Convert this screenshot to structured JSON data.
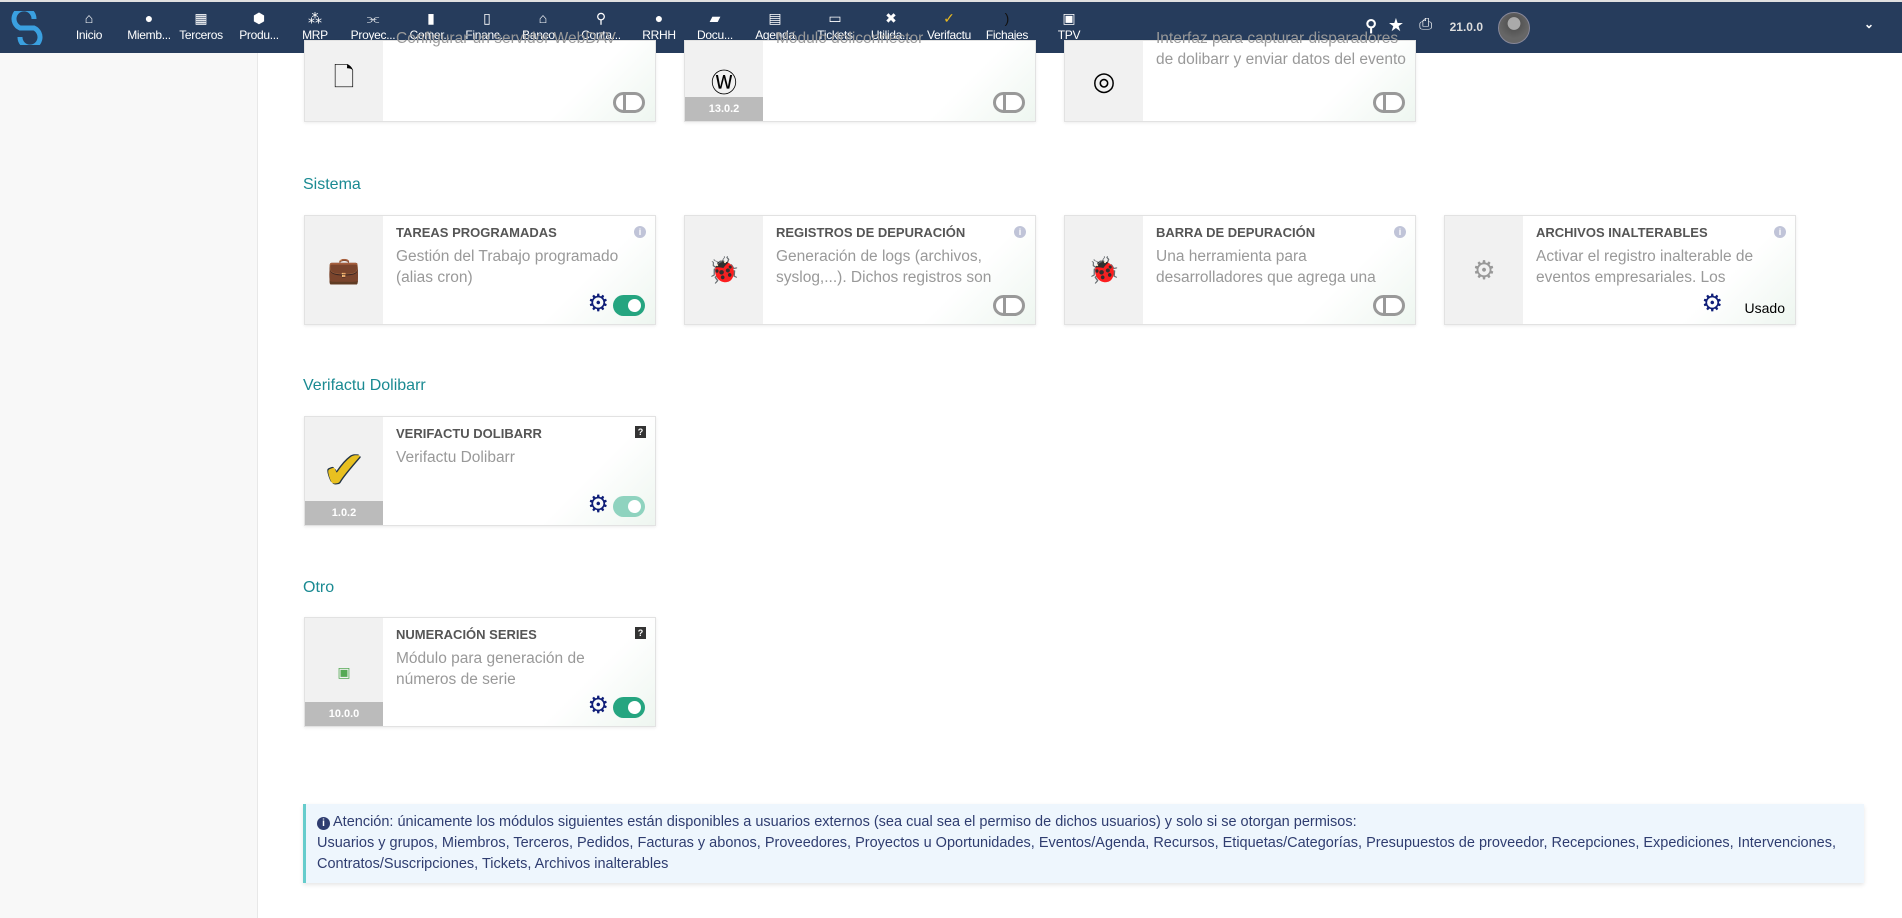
{
  "nav": {
    "items": [
      {
        "label": "Inicio",
        "icon": "home-icon",
        "glyph": "⌂"
      },
      {
        "label": "Miemb...",
        "icon": "user-icon",
        "glyph": "●"
      },
      {
        "label": "Terceros",
        "icon": "building-icon",
        "glyph": "▦"
      },
      {
        "label": "Produ...",
        "icon": "cube-icon",
        "glyph": "⬢"
      },
      {
        "label": "MRP",
        "icon": "cubes-icon",
        "glyph": "⁂"
      },
      {
        "label": "Proyec...",
        "icon": "project-diagram-icon",
        "glyph": "⫘"
      },
      {
        "label": "Comer...",
        "icon": "suitcase-icon",
        "glyph": "▮"
      },
      {
        "label": "Financ...",
        "icon": "invoice-icon",
        "glyph": "▯"
      },
      {
        "label": "Banco...",
        "icon": "bank-icon",
        "glyph": "⌂"
      },
      {
        "label": "Conta...",
        "icon": "search-dollar-icon",
        "glyph": "⚲"
      },
      {
        "label": "RRHH",
        "icon": "user-tie-icon",
        "glyph": "●"
      },
      {
        "label": "Docu...",
        "icon": "folder-open-icon",
        "glyph": "▰"
      },
      {
        "label": "Agenda",
        "icon": "calendar-icon",
        "glyph": "▤"
      },
      {
        "label": "Tickets",
        "icon": "ticket-icon",
        "glyph": "▭"
      },
      {
        "label": "Utilida...",
        "icon": "tools-icon",
        "glyph": "✖"
      },
      {
        "label": "Verifactu",
        "icon": "checkmark-icon",
        "glyph": "✓"
      },
      {
        "label": "Fichajes",
        "icon": "clock-in-icon",
        "glyph": ")"
      },
      {
        "label": "TPV",
        "icon": "cash-register-icon",
        "glyph": "▣"
      }
    ],
    "version": "21.0.0"
  },
  "top_cards": [
    {
      "desc": "Configurar un servidor WebDAV",
      "icon": "file-icon",
      "glyph": "🗋",
      "toggle": "off"
    },
    {
      "desc": "Módulo doliconnector",
      "icon": "wordpress-icon",
      "glyph": "Ⓦ",
      "version": "13.0.2",
      "toggle": "off"
    },
    {
      "desc": "Interfaz para capturar disparadores de dolibarr y enviar datos del evento a...",
      "icon": "target-icon",
      "glyph": "◎",
      "toggle": "off"
    }
  ],
  "sections": [
    {
      "title": "Sistema",
      "cards": [
        {
          "title": "TAREAS PROGRAMADAS",
          "desc": "Gestión del Trabajo programado (alias cron)",
          "icon": "briefcase-clock-icon",
          "glyph": "💼",
          "badge": "info",
          "gear": true,
          "toggle": "on"
        },
        {
          "title": "REGISTROS DE DEPURACIÓN",
          "desc": "Generación de logs (archivos, syslog,...). Dichos registros son para...",
          "icon": "bug-icon",
          "glyph": "🐞",
          "badge": "info",
          "toggle": "off"
        },
        {
          "title": "BARRA DE DEPURACIÓN",
          "desc": "Una herramienta para desarrolladores que agrega una barra de depuración...",
          "icon": "bug-icon",
          "glyph": "🐞",
          "badge": "info",
          "toggle": "off"
        },
        {
          "title": "ARCHIVOS INALTERABLES",
          "desc": "Activar el registro inalterable de eventos empresariales. Los eventos...",
          "icon": "cogs-icon",
          "glyph": "⚙",
          "badge": "info",
          "gear": true,
          "status": "Usado"
        }
      ]
    },
    {
      "title": "Verifactu Dolibarr",
      "cards": [
        {
          "title": "VERIFACTU DOLIBARR",
          "desc": "Verifactu Dolibarr",
          "icon": "checkmark-icon",
          "glyph": "✔",
          "version": "1.0.2",
          "badge": "help",
          "gear": true,
          "toggle": "dim"
        }
      ]
    },
    {
      "title": "Otro",
      "cards": [
        {
          "title": "NUMERACIÓN SERIES",
          "desc": "Módulo para generación de números de serie",
          "icon": "image-icon",
          "glyph": "▣",
          "version": "10.0.0",
          "badge": "help",
          "gear": true,
          "toggle": "on"
        }
      ]
    }
  ],
  "notice": {
    "line1": "Atención: únicamente los módulos siguientes están disponibles a usuarios externos (sea cual sea el permiso de dichos usuarios) y solo si se otorgan permisos:",
    "line2": "Usuarios y grupos, Miembros, Terceros, Pedidos, Facturas y abonos, Proveedores, Proyectos u Oportunidades, Eventos/Agenda, Recursos, Etiquetas/Categorías, Presupuestos de proveedor, Recepciones, Expediciones, Intervenciones, Contratos/Suscripciones, Tickets, Archivos inalterables"
  },
  "colors": {
    "nav": "#263c5c",
    "accent": "#1a8a92",
    "toggle_on": "#25a580",
    "gear": "#0f1e78"
  }
}
